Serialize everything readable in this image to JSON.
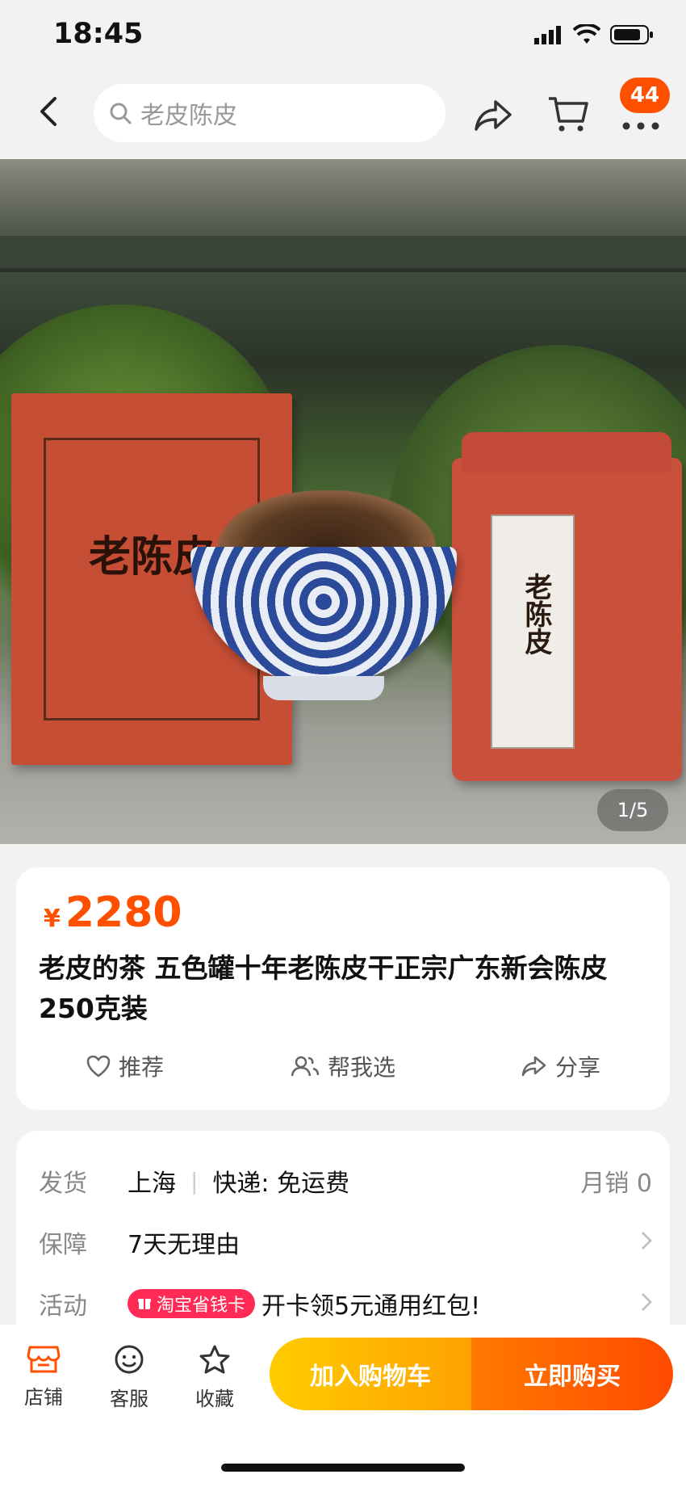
{
  "status_bar": {
    "time": "18:45"
  },
  "nav": {
    "search_placeholder": "老皮陈皮",
    "badge_count": "44"
  },
  "gallery": {
    "pager": "1/5",
    "box_title": "老陈皮",
    "jar_label": "老陈皮"
  },
  "product": {
    "currency": "¥",
    "price": "2280",
    "title": "老皮的茶 五色罐十年老陈皮干正宗广东新会陈皮250克装",
    "actions": [
      {
        "label": "推荐",
        "icon": "heart-icon"
      },
      {
        "label": "帮我选",
        "icon": "users-icon"
      },
      {
        "label": "分享",
        "icon": "share-icon"
      }
    ]
  },
  "details": {
    "shipping": {
      "label": "发货",
      "from": "上海",
      "delivery": "快递: 免运费",
      "monthly_sales": "月销 0"
    },
    "guarantee": {
      "label": "保障",
      "value": "7天无理由"
    },
    "promo": {
      "label": "活动",
      "tag": "淘宝省钱卡",
      "value": "开卡领5元通用红包!"
    }
  },
  "bottom_bar": {
    "tabs": [
      {
        "label": "店铺",
        "icon": "store-icon"
      },
      {
        "label": "客服",
        "icon": "customer-service-icon"
      },
      {
        "label": "收藏",
        "icon": "star-icon"
      }
    ],
    "add_to_cart": "加入购物车",
    "buy_now": "立即购买"
  },
  "colors": {
    "accent": "#ff5000",
    "cart_button": "#ffb400",
    "buy_button": "#ff5a00"
  }
}
